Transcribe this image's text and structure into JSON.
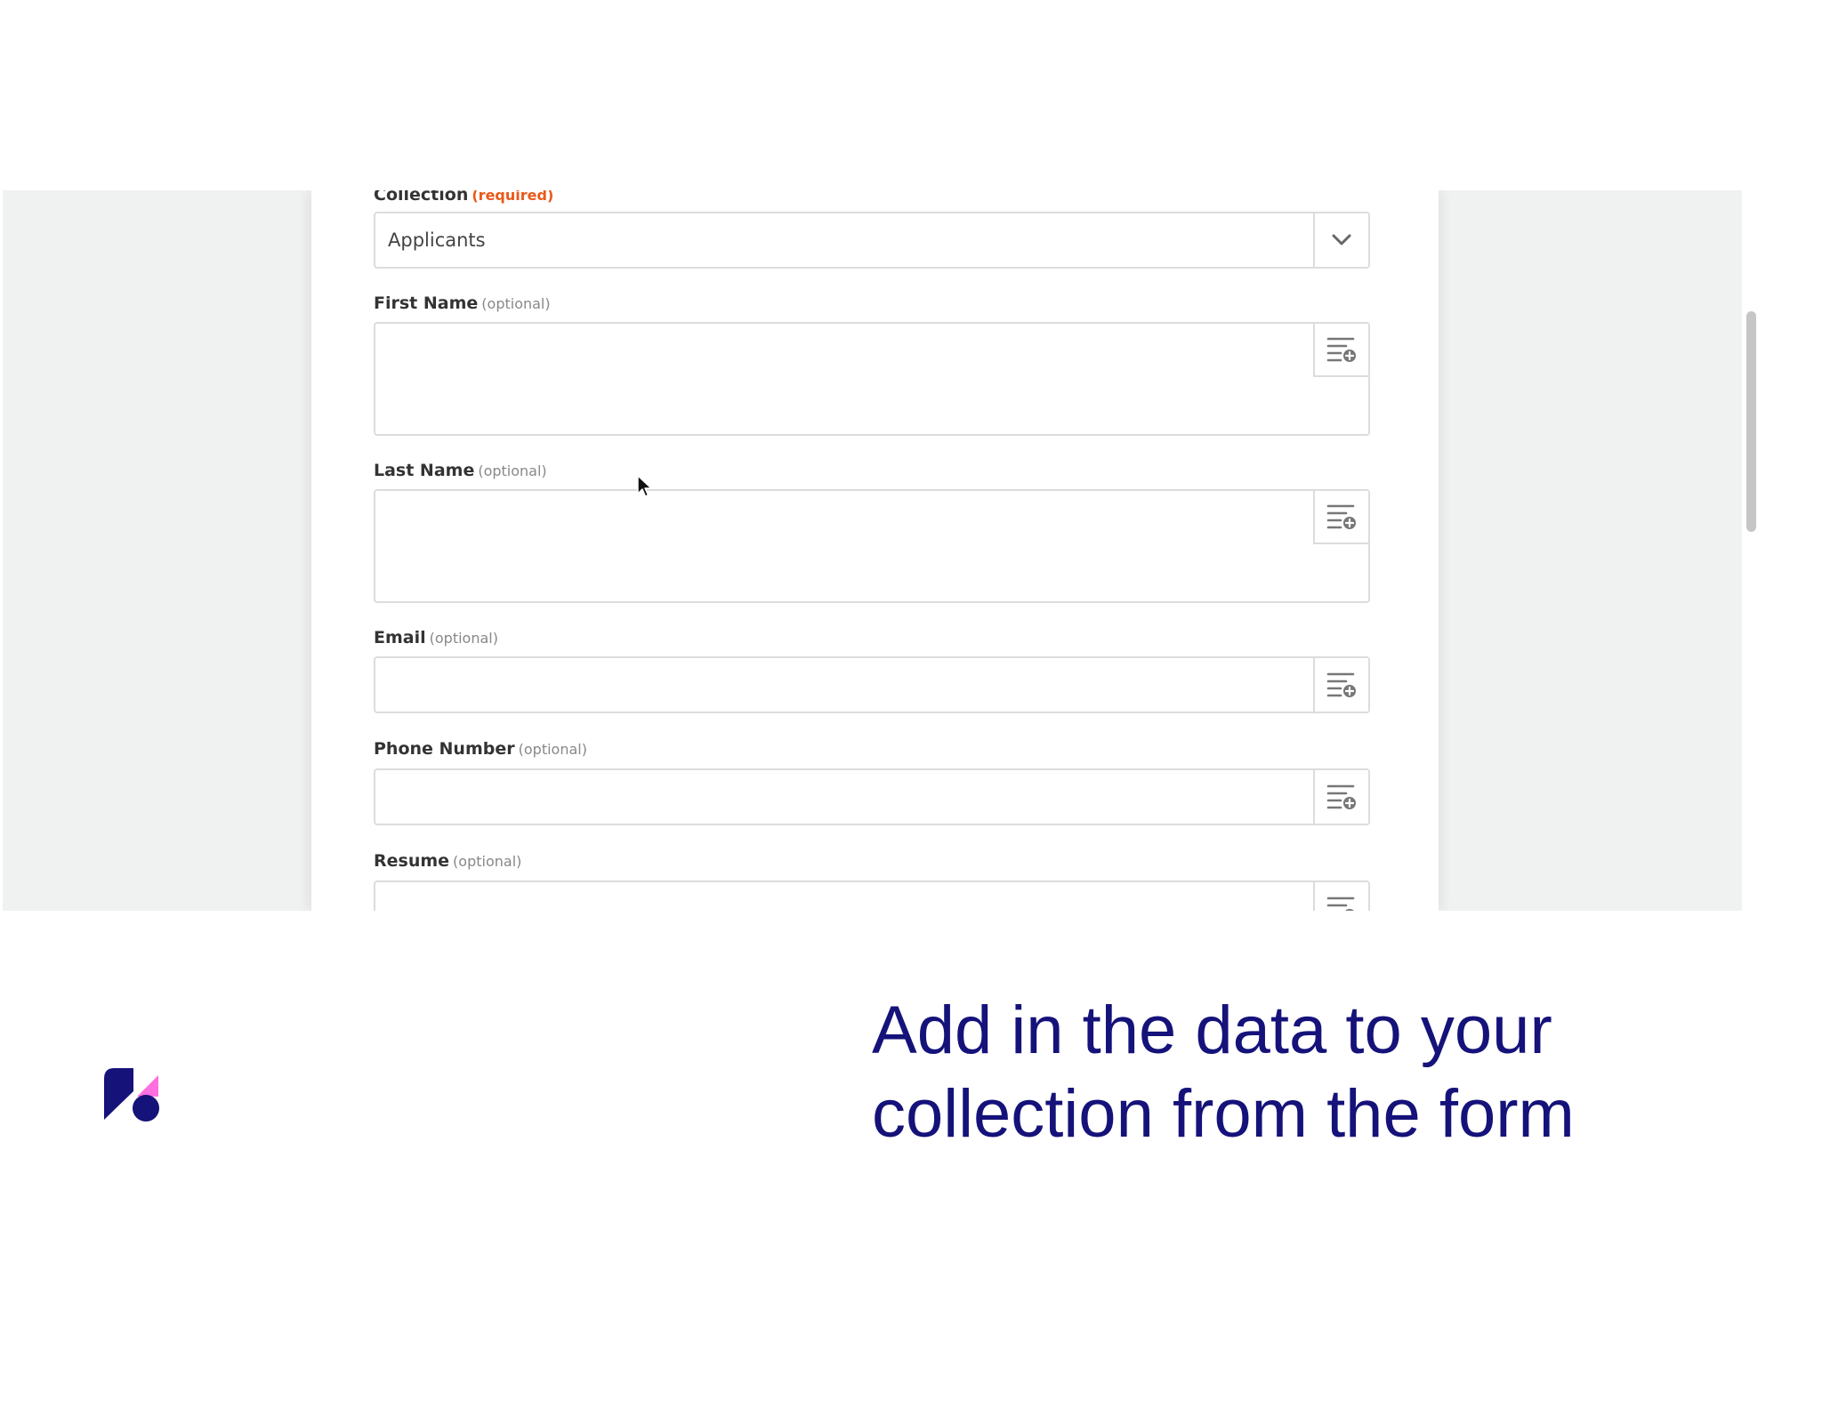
{
  "form": {
    "collection": {
      "label": "Collection",
      "tag": "(required)",
      "value": "Applicants"
    },
    "fields": [
      {
        "label": "First Name",
        "tag": "(optional)"
      },
      {
        "label": "Last Name",
        "tag": "(optional)"
      },
      {
        "label": "Email",
        "tag": "(optional)"
      },
      {
        "label": "Phone Number",
        "tag": "(optional)"
      },
      {
        "label": "Resume",
        "tag": "(optional)"
      }
    ]
  },
  "sidebar": {
    "buttons": [
      "details-panel-icon",
      "alert-icon",
      "clock-icon",
      "gear-icon"
    ]
  },
  "caption": {
    "line1": "Add in the data to your",
    "line2": "collection from the form"
  },
  "colors": {
    "required": "#e8591a",
    "caption": "#15127a",
    "logo_navy": "#15127a",
    "logo_pink": "#ff6fe0"
  }
}
